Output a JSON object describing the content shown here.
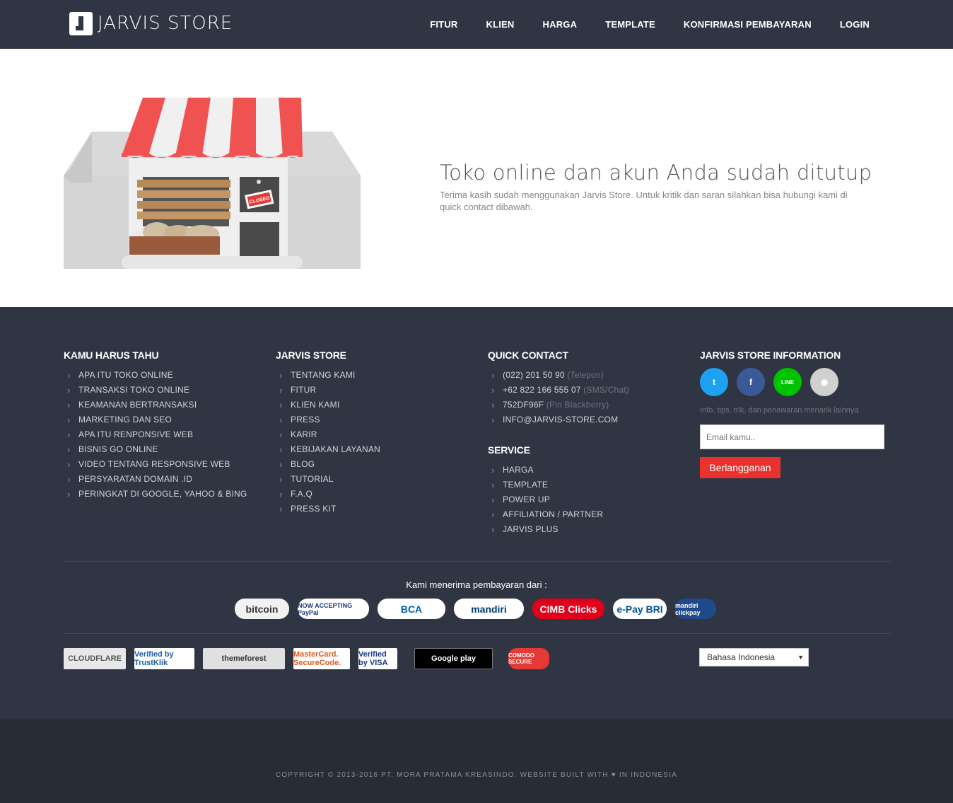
{
  "brand": {
    "name": "JARVIS STORE"
  },
  "nav": [
    "FITUR",
    "KLIEN",
    "HARGA",
    "TEMPLATE",
    "KONFIRMASI PEMBAYARAN",
    "LOGIN"
  ],
  "hero": {
    "sign": "CLOSED",
    "title": "Toko online dan akun Anda sudah ditutup",
    "description": "Terima kasih sudah menggunakan Jarvis Store. Untuk kritik dan saran silahkan bisa hubungi kami di quick contact dibawah."
  },
  "footer": {
    "col1": {
      "title": "KAMU HARUS TAHU",
      "items": [
        "APA ITU TOKO ONLINE",
        "TRANSAKSI TOKO ONLINE",
        "KEAMANAN BERTRANSAKSI",
        "MARKETING DAN SEO",
        "APA ITU RENPONSIVE WEB",
        "BISNIS GO ONLINE",
        "VIDEO TENTANG RESPONSIVE WEB",
        "PERSYARATAN DOMAIN .ID",
        "PERINGKAT DI GOOGLE, YAHOO & BING"
      ]
    },
    "col2": {
      "title": "JARVIS STORE",
      "items": [
        "TENTANG KAMI",
        "FITUR",
        "KLIEN KAMI",
        "PRESS",
        "KARIR",
        "KEBIJAKAN LAYANAN",
        "BLOG",
        "TUTORIAL",
        "F.A.Q",
        "PRESS KIT"
      ]
    },
    "contact": {
      "title": "QUICK CONTACT",
      "items": [
        {
          "value": "(022) 201 50 90",
          "note": "(Telepon)"
        },
        {
          "value": "+62 822 166 555 07",
          "note": "(SMS/Chat)"
        },
        {
          "value": "752DF96F",
          "note": "(Pin Blackberry)"
        },
        {
          "value": "INFO@JARVIS-STORE.COM",
          "note": ""
        }
      ]
    },
    "service": {
      "title": "SERVICE",
      "items": [
        "HARGA",
        "TEMPLATE",
        "POWER UP",
        "AFFILIATION / PARTNER",
        "JARVIS PLUS"
      ]
    },
    "info": {
      "title": "JARVIS STORE INFORMATION",
      "social": [
        {
          "icon": "twitter-icon",
          "glyph": "t",
          "color": "#1da1f2"
        },
        {
          "icon": "facebook-icon",
          "glyph": "f",
          "color": "#3b5998"
        },
        {
          "icon": "line-icon",
          "glyph": "LINE",
          "color": "#00c300"
        },
        {
          "icon": "rss-icon",
          "glyph": "◉",
          "color": "#d0d0d0"
        }
      ],
      "note": "Info, tips, trik, dan penawaran menarik lainnya",
      "email_placeholder": "Email kamu..",
      "subscribe_label": "Berlangganan"
    },
    "payment_title": "Kami menerima pembayaran dari :",
    "payments": [
      {
        "name": "bitcoin",
        "label": "bitcoin",
        "color": "#333"
      },
      {
        "name": "paypal",
        "label": "NOW ACCEPTING PayPal",
        "color": "#1a3a7a"
      },
      {
        "name": "bca",
        "label": "BCA",
        "color": "#0060af"
      },
      {
        "name": "mandiri",
        "label": "mandiri",
        "color": "#003a70"
      },
      {
        "name": "cimb",
        "label": "CIMB Clicks",
        "color": "#fff"
      },
      {
        "name": "epay-bri",
        "label": "e-Pay BRI",
        "color": "#00529c"
      },
      {
        "name": "mandiri-clickpay",
        "label": "mandiri clickpay",
        "color": "#fff"
      }
    ],
    "badges": [
      {
        "name": "cloudflare",
        "label": "CLOUDFLARE"
      },
      {
        "name": "trustklik",
        "label": "Verified by TrustKlik"
      },
      {
        "name": "themeforest",
        "label": "themeforest"
      },
      {
        "name": "mastercard",
        "label": "MasterCard. SecureCode."
      },
      {
        "name": "visa",
        "label": "Verified by VISA"
      },
      {
        "name": "google-play",
        "label": "Google play"
      },
      {
        "name": "comodo",
        "label": "COMODO SECURE"
      }
    ],
    "language": "Bahasa Indonesia",
    "copyright": "COPYRIGHT © 2013-2016 PT. MORA PRATAMA KREASINDO. WEBSITE BUILT WITH ♥ IN INDONESIA"
  }
}
